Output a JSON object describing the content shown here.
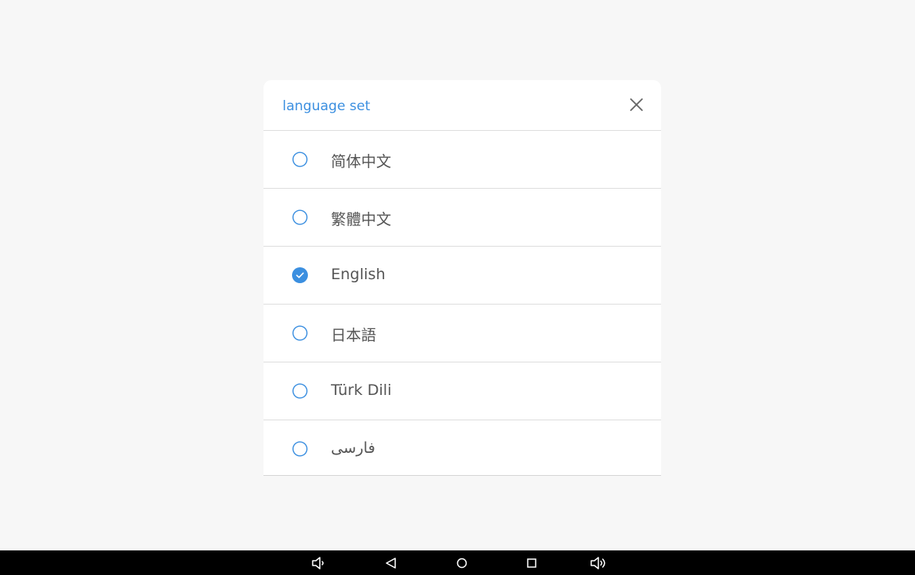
{
  "dialog": {
    "title": "language set",
    "close_icon": "close-icon",
    "options": [
      {
        "label": "简体中文",
        "selected": false
      },
      {
        "label": "繁體中文",
        "selected": false
      },
      {
        "label": "English",
        "selected": true
      },
      {
        "label": "日本語",
        "selected": false
      },
      {
        "label": "Türk Dili",
        "selected": false
      },
      {
        "label": "فارسی",
        "selected": false
      }
    ]
  },
  "navbar": {
    "buttons": [
      "volume-down-icon",
      "back-icon",
      "home-icon",
      "recents-icon",
      "volume-up-icon"
    ]
  },
  "colors": {
    "accent": "#3b8fe0",
    "background": "#f7f7f7",
    "dialog": "#ffffff",
    "navbar": "#000000",
    "text": "#555555"
  }
}
